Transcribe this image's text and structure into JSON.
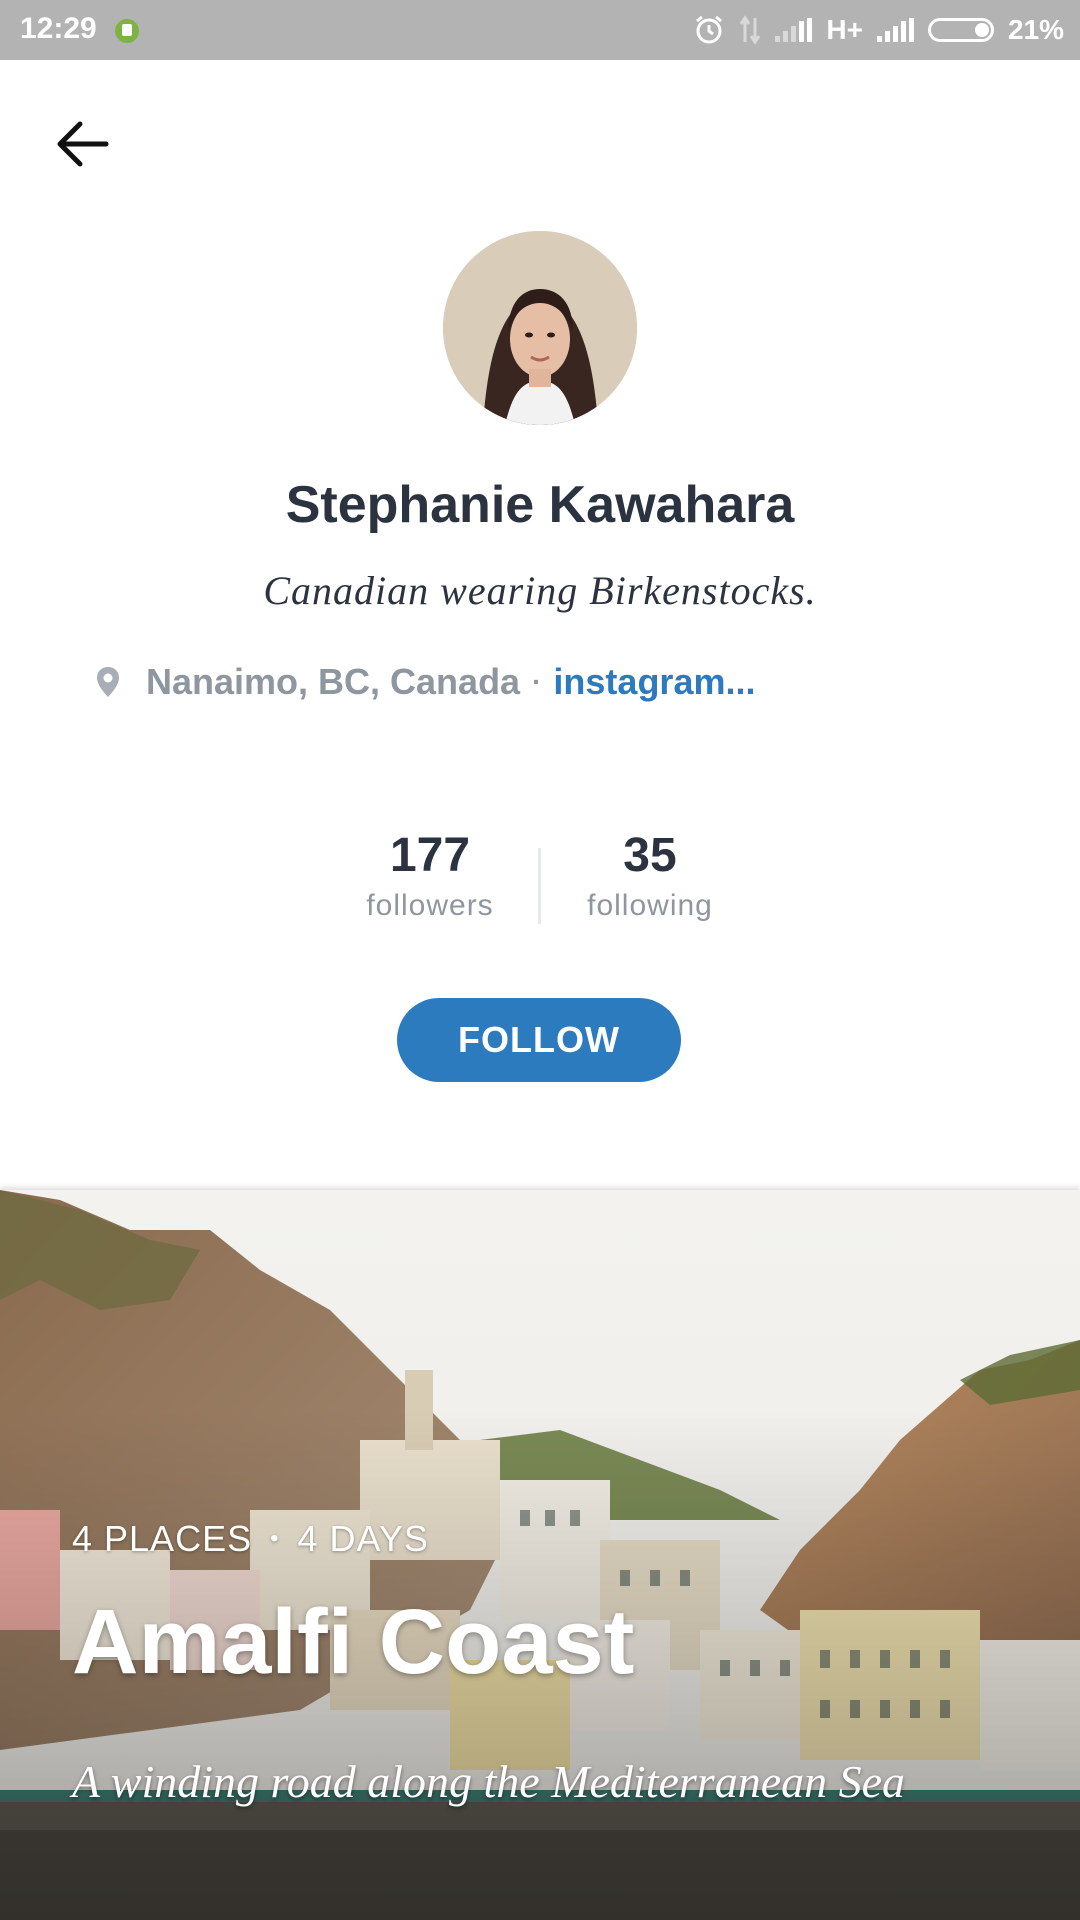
{
  "status_bar": {
    "time": "12:29",
    "network": "H+",
    "battery": "21%"
  },
  "profile": {
    "name": "Stephanie Kawahara",
    "bio": "Canadian wearing Birkenstocks.",
    "location": "Nanaimo, BC, Canada",
    "separator": "·",
    "link": "instagram..."
  },
  "stats": {
    "followers": {
      "count": "177",
      "label": "followers"
    },
    "following": {
      "count": "35",
      "label": "following"
    }
  },
  "actions": {
    "follow_label": "FOLLOW"
  },
  "trip": {
    "places": "4 PLACES",
    "separator": "•",
    "days": "4 DAYS",
    "title": "Amalfi Coast",
    "description": "A winding road along the Mediterranean Sea"
  },
  "colors": {
    "accent": "#2c7bbf",
    "primary_text": "#2c3340",
    "secondary_text": "#8e96a0",
    "status_bar": "#b3b3b3"
  },
  "icons": [
    "alarm-icon",
    "data-arrows-icon",
    "signal-icon",
    "battery-icon",
    "back-arrow-icon",
    "location-pin-icon"
  ]
}
